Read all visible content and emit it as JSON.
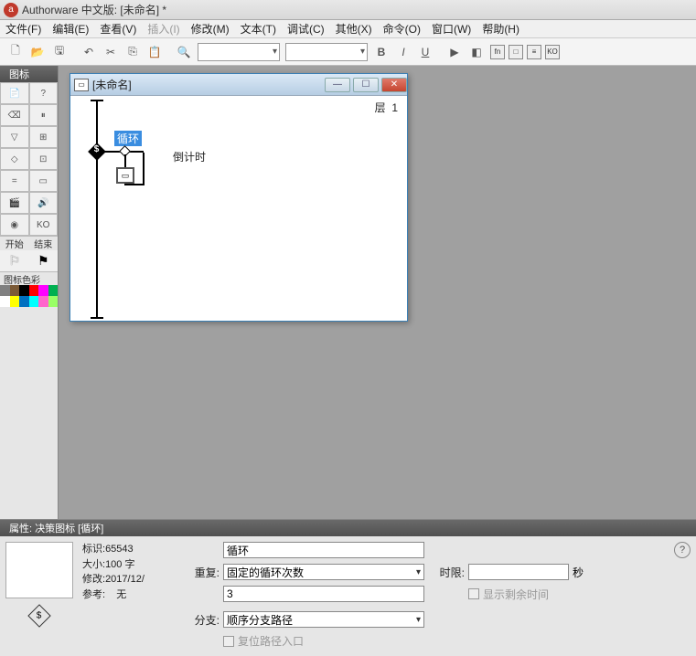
{
  "title": "Authorware 中文版: [未命名] *",
  "menu": {
    "file": "文件(F)",
    "edit": "编辑(E)",
    "view": "查看(V)",
    "insert": "插入(I)",
    "modify": "修改(M)",
    "text": "文本(T)",
    "debug": "调试(C)",
    "other": "其他(X)",
    "command": "命令(O)",
    "window": "窗口(W)",
    "help": "帮助(H)"
  },
  "toolbar": {
    "bold": "B",
    "italic": "I",
    "underline": "U"
  },
  "icon_panel": {
    "title": "图标",
    "start": "开始",
    "end": "结束",
    "colors_title": "图标色彩",
    "colors": [
      "#808080",
      "#7b5a36",
      "#000000",
      "#ff0000",
      "#ff00ff",
      "#00b050",
      "#ffffff",
      "#ffff00",
      "#0070c0",
      "#00ffff",
      "#ff66cc",
      "#99ff66"
    ]
  },
  "flow": {
    "title": "[未命名]",
    "layer_label": "层",
    "layer_value": "1",
    "loop_label": "循环",
    "countdown_label": "倒计时"
  },
  "prop": {
    "title": "属性: 决策图标 [循环]",
    "meta": {
      "id_label": "标识:",
      "id_value": "65543",
      "size_label": "大小:",
      "size_value": "100 字",
      "mod_label": "修改:",
      "mod_value": "2017/12/",
      "ref_label": "参考:",
      "ref_value": "无"
    },
    "name_value": "循环",
    "repeat_label": "重复:",
    "repeat_option": "固定的循环次数",
    "repeat_count": "3",
    "branch_label": "分支:",
    "branch_option": "顺序分支路径",
    "reset_label": "复位路径入口",
    "timelimit_label": "时限:",
    "seconds_label": "秒",
    "show_time_label": "显示剩余时间",
    "diamond_symbol": "$"
  }
}
